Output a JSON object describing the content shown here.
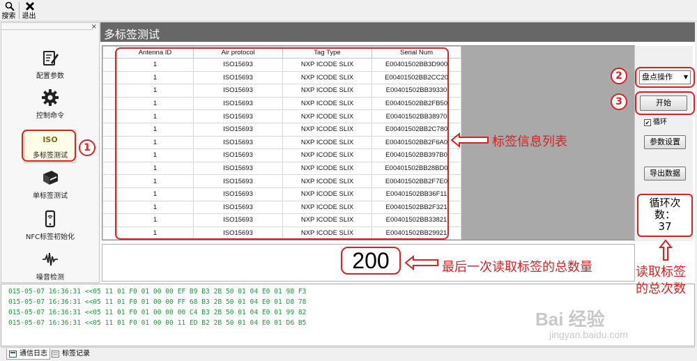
{
  "toolbar": {
    "search_label": "搜索",
    "exit_label": "退出"
  },
  "sidebar": {
    "items": [
      {
        "label": "配置参数",
        "icon": "config-icon"
      },
      {
        "label": "控制命令",
        "icon": "gear-icon"
      },
      {
        "label": "多标签测试",
        "icon": "iso-icon",
        "icon_text": "ISO",
        "active": true
      },
      {
        "label": "单标签测试",
        "icon": "book-icon"
      },
      {
        "label": "NFC标签初始化",
        "icon": "phone-nfc-icon"
      },
      {
        "label": "噪音检测",
        "icon": "waveform-icon"
      }
    ]
  },
  "main": {
    "title": "多标签测试",
    "table": {
      "columns": [
        "Antenna ID",
        "Air protocol",
        "Tag Type",
        "Serial Num"
      ],
      "rows": [
        [
          "1",
          "ISO15693",
          "NXP ICODE SLIX",
          "E00401502BB3D900"
        ],
        [
          "1",
          "ISO15693",
          "NXP ICODE SLIX",
          "E00401502BB2CC20"
        ],
        [
          "1",
          "ISO15693",
          "NXP ICODE SLIX",
          "E00401502BB39330"
        ],
        [
          "1",
          "ISO15693",
          "NXP ICODE SLIX",
          "E00401502BB2FB50"
        ],
        [
          "1",
          "ISO15693",
          "NXP ICODE SLIX",
          "E00401502BB38970"
        ],
        [
          "1",
          "ISO15693",
          "NXP ICODE SLIX",
          "E00401502BB2C780"
        ],
        [
          "1",
          "ISO15693",
          "NXP ICODE SLIX",
          "E00401502BB2F6A0"
        ],
        [
          "1",
          "ISO15693",
          "NXP ICODE SLIX",
          "E00401502BB397B0"
        ],
        [
          "1",
          "ISO15693",
          "NXP ICODE SLIX",
          "E00401502BB28BD0"
        ],
        [
          "1",
          "ISO15693",
          "NXP ICODE SLIX",
          "E00401502BB2F7E0"
        ],
        [
          "1",
          "ISO15693",
          "NXP ICODE SLIX",
          "E00401502BB36F11"
        ],
        [
          "1",
          "ISO15693",
          "NXP ICODE SLIX",
          "E00401502BB2F321"
        ],
        [
          "1",
          "ISO15693",
          "NXP ICODE SLIX",
          "E00401502BB33821"
        ],
        [
          "1",
          "ISO15693",
          "NXP ICODE SLIX",
          "E00401502BB29921"
        ]
      ]
    },
    "total_count": "200"
  },
  "controls": {
    "mode_select": "盘点操作",
    "start_button": "开始",
    "loop_checkbox": "循环",
    "loop_checked": true,
    "settings_button": "参数设置",
    "export_button": "导出数据"
  },
  "loop_counter": {
    "line1": "循环次",
    "line2": "数：",
    "value": "37"
  },
  "annotations": {
    "badge1": "1",
    "badge2": "2",
    "badge3": "3",
    "tag_list_note": "标签信息列表",
    "last_read_note": "最后一次读取标签的总数量",
    "total_reads_note_line1": "读取标签",
    "total_reads_note_line2": "的总次数",
    "color": "#e02020"
  },
  "log": {
    "lines": [
      "015-05-07 16:36:31  <<05 11 01 F0 01 00 00 EF B9 B3 2B 50 01 04 E0 01 98 F3",
      "015-05-07 16:36:31  <<05 11 01 F0 01 00 00 FF 68 B3 2B 50 01 04 E0 01 D8 78",
      "015-05-07 16:36:31  <<05 11 01 F0 01 00 00 00 C4 B3 2B 50 01 04 E0 01 99 82",
      "015-05-07 16:36:31  <<05 11 01 F0 01 00 00 11 ED B2 2B 50 01 04 E0 01 D6 B5"
    ],
    "color": "#1a9a3a"
  },
  "bottom_tabs": [
    {
      "label": "通信日志",
      "active": true
    },
    {
      "label": "标签记录",
      "active": false
    }
  ],
  "watermark": {
    "main": "Bai 经验",
    "sub": "jingyan.baidu.com"
  }
}
